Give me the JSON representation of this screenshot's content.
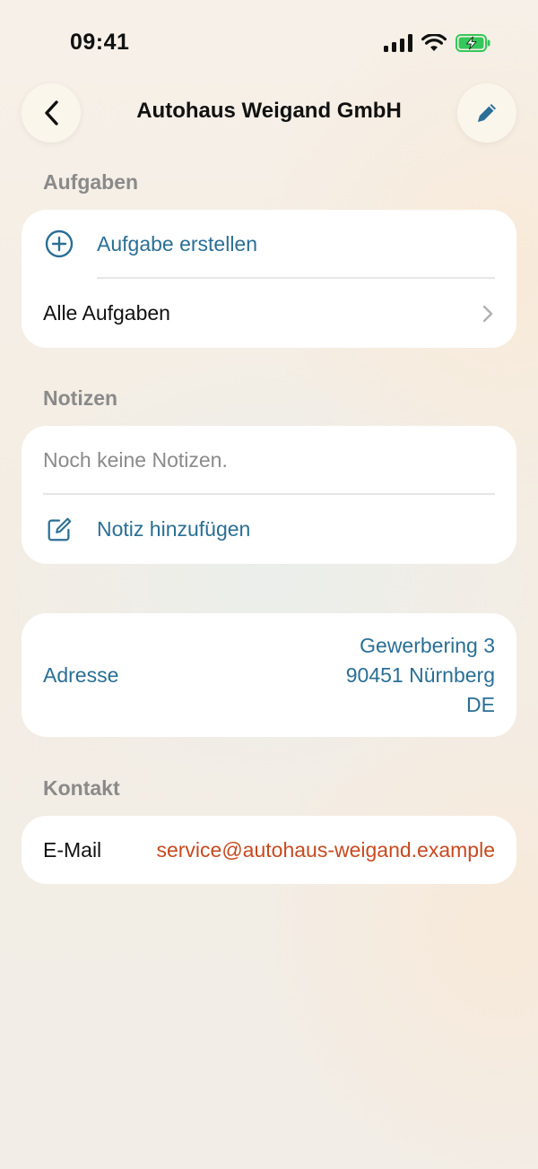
{
  "status_bar": {
    "time": "09:41",
    "icons": [
      "cellular-signal-icon",
      "wifi-icon",
      "battery-charging-icon"
    ]
  },
  "nav": {
    "title": "Autohaus Weigand GmbH",
    "back_icon": "chevron-left-icon",
    "edit_icon": "pencil-icon"
  },
  "tasks": {
    "header": "Aufgaben",
    "create_label": "Aufgabe erstellen",
    "create_icon": "plus-circle-icon",
    "all_label": "Alle Aufgaben",
    "all_icon": "chevron-right-icon"
  },
  "notes": {
    "header": "Notizen",
    "empty_text": "Noch keine Notizen.",
    "add_label": "Notiz hinzufügen",
    "add_icon": "compose-icon"
  },
  "address": {
    "label": "Adresse",
    "lines": [
      "Gewerbering 3",
      "90451 Nürnberg",
      "DE"
    ]
  },
  "contact": {
    "header": "Kontakt",
    "email_label": "E-Mail",
    "email_value": "service@autohaus-weigand.example"
  },
  "colors": {
    "accent": "#2a6f96",
    "email": "#c8491f",
    "muted": "#8a8a8a",
    "card": "#ffffff",
    "background": "#f4eee6",
    "battery": "#34c759"
  }
}
